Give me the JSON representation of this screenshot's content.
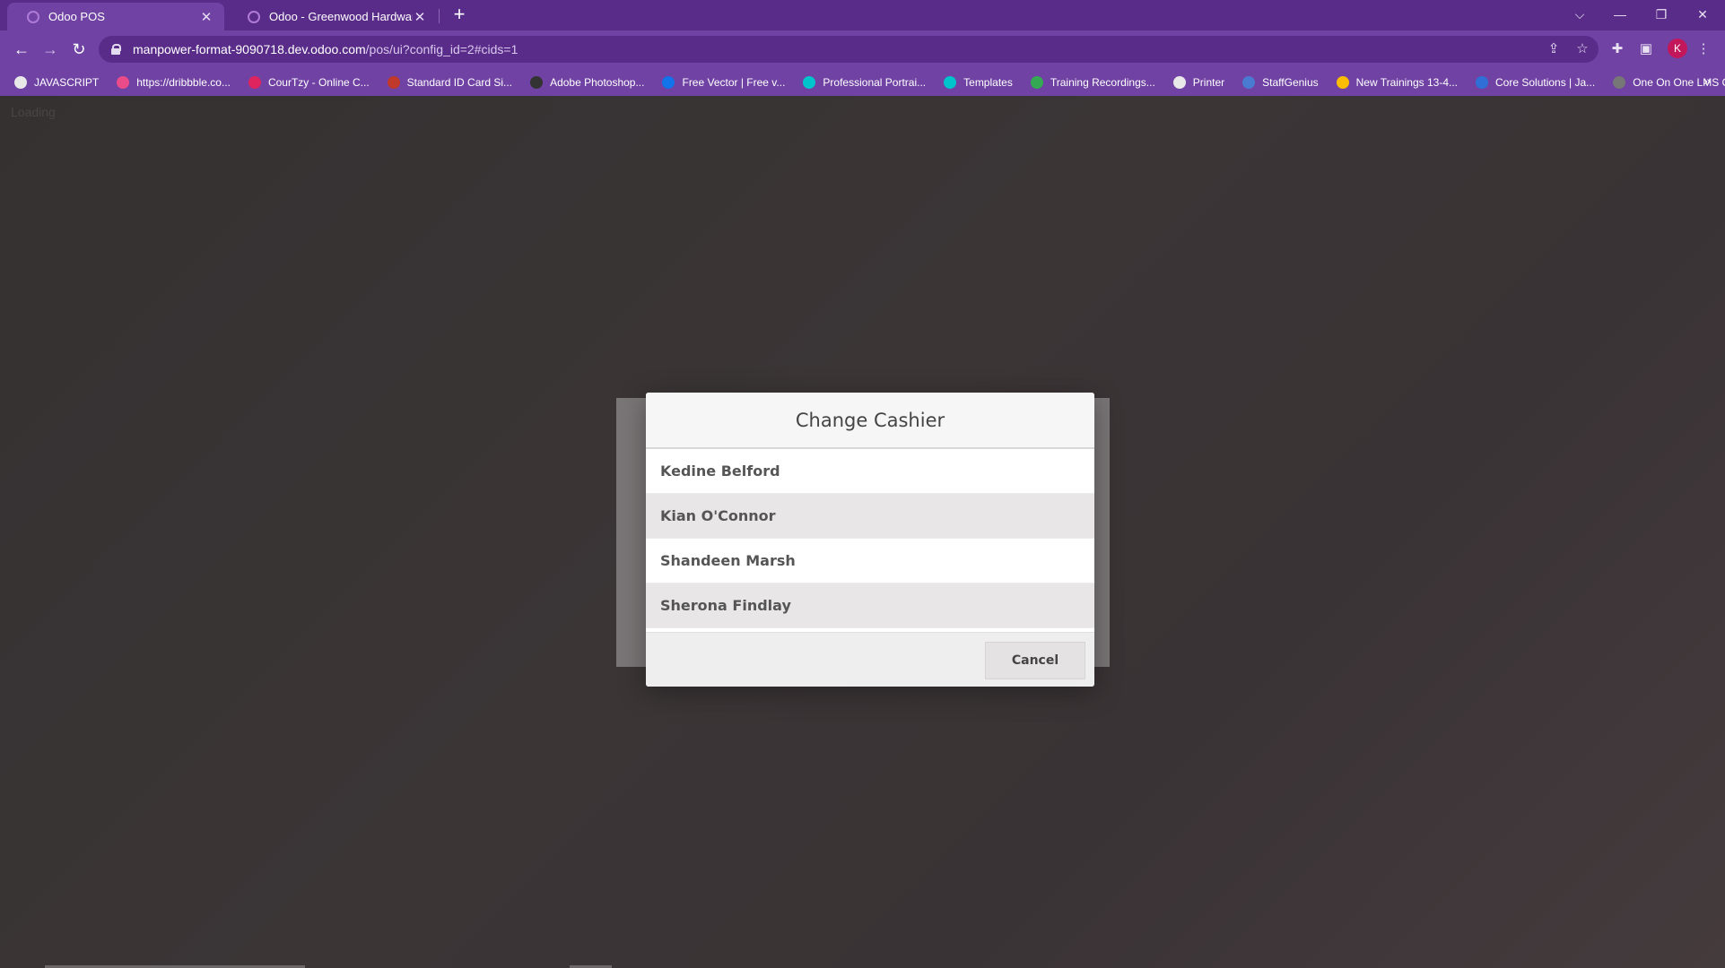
{
  "tabs": [
    {
      "title": "Odoo POS",
      "active": true
    },
    {
      "title": "Odoo - Greenwood Hardware",
      "active": false
    }
  ],
  "new_tab": "+",
  "window_controls": {
    "dropdown": "⌵",
    "minimize": "—",
    "restore": "❐",
    "close": "✕"
  },
  "nav": {
    "back": "←",
    "forward": "→",
    "reload": "↻"
  },
  "address_bar": {
    "host": "manpower-format-9090718.dev.odoo.com",
    "path": "/pos/ui?config_id=2#cids=1"
  },
  "profile_initial": "K",
  "bookmarks": [
    {
      "label": "JAVASCRIPT",
      "icon": "globe-icon",
      "color": "#e8e8e8"
    },
    {
      "label": "https://dribbble.co...",
      "icon": "dribbble-icon",
      "color": "#ea4c89"
    },
    {
      "label": "CourTzy - Online C...",
      "icon": "courtzy-icon",
      "color": "#e0245e"
    },
    {
      "label": "Standard ID Card Si...",
      "icon": "idcard-icon",
      "color": "#c0392b"
    },
    {
      "label": "Adobe Photoshop...",
      "icon": "g-icon",
      "color": "#333333"
    },
    {
      "label": "Free Vector | Free v...",
      "icon": "freepik-icon",
      "color": "#1273eb"
    },
    {
      "label": "Professional Portrai...",
      "icon": "canva-icon",
      "color": "#00c4cc"
    },
    {
      "label": "Templates",
      "icon": "canva-icon",
      "color": "#00c4cc"
    },
    {
      "label": "Training Recordings...",
      "icon": "drive-icon",
      "color": "#34a853"
    },
    {
      "label": "Printer",
      "icon": "globe-icon",
      "color": "#e8e8e8"
    },
    {
      "label": "StaffGenius",
      "icon": "staffgenius-icon",
      "color": "#4a7bd0"
    },
    {
      "label": "New Trainings 13-4...",
      "icon": "drive-icon",
      "color": "#fbbc04"
    },
    {
      "label": "Core Solutions | Ja...",
      "icon": "core-icon",
      "color": "#2f6fd6"
    },
    {
      "label": "One On One LMS O...",
      "icon": "lms-icon",
      "color": "#777777"
    }
  ],
  "bookmarks_more": "»",
  "page": {
    "loading_text": "Loading",
    "dialog": {
      "title": "Change Cashier",
      "cashiers": [
        "Kedine Belford",
        "Kian O'Connor",
        "Shandeen Marsh",
        "Sherona Findlay"
      ],
      "cancel_label": "Cancel"
    }
  },
  "colors": {
    "chrome_accent": "#6f42a4",
    "tabstrip": "#5a2c8a"
  }
}
